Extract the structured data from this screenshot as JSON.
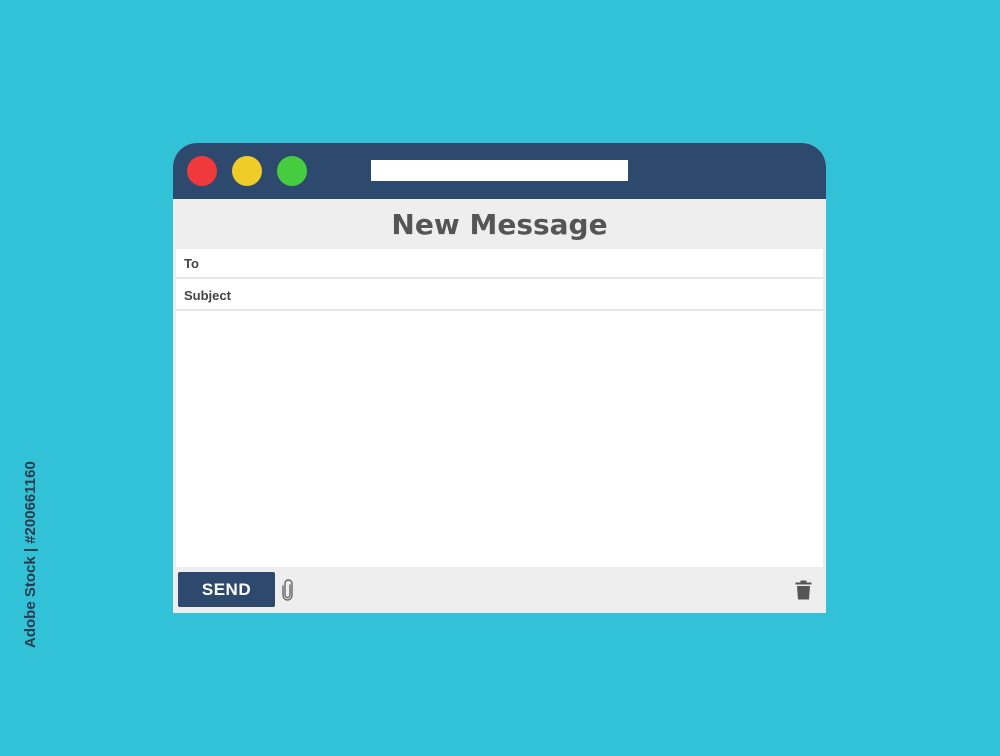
{
  "window": {
    "address_value": "",
    "header_title": "New Message"
  },
  "fields": {
    "to_label": "To",
    "subject_label": "Subject"
  },
  "footer": {
    "send_label": "SEND"
  },
  "icons": {
    "attach": "paperclip-icon",
    "delete": "trash-icon"
  },
  "colors": {
    "background": "#32c2d8",
    "titlebar": "#2d4a6e",
    "close": "#f0393b",
    "minimize": "#f0cc29",
    "maximize": "#45cc3f",
    "panel": "#eeeeee"
  },
  "side_text": "Adobe Stock | #200661160"
}
